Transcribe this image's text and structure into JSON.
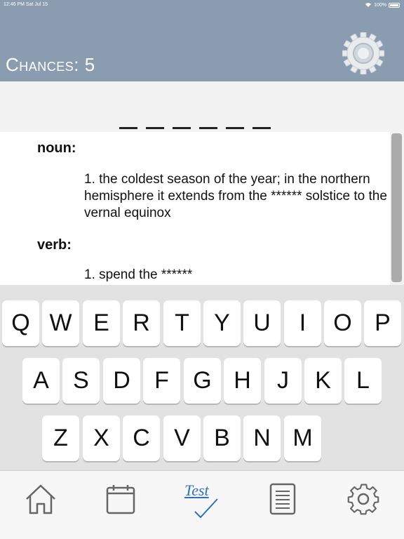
{
  "status": {
    "time": "12:46 PM  Sat Jul 15",
    "battery": "100%"
  },
  "header": {
    "chances_label": "Chances: 5"
  },
  "word": {
    "blank_count": 6
  },
  "definitions": [
    {
      "pos": "noun:",
      "text": "1. the coldest season of the year; in the northern hemisphere it extends from the ****** solstice to the vernal equinox"
    },
    {
      "pos": "verb:",
      "text": "1. spend the ******"
    }
  ],
  "keyboard": {
    "row1": [
      "Q",
      "W",
      "E",
      "R",
      "T",
      "Y",
      "U",
      "I",
      "O",
      "P"
    ],
    "row2": [
      "A",
      "S",
      "D",
      "F",
      "G",
      "H",
      "J",
      "K",
      "L"
    ],
    "row3": [
      "Z",
      "X",
      "C",
      "V",
      "B",
      "N",
      "M"
    ]
  },
  "tabs": [
    {
      "name": "home-icon"
    },
    {
      "name": "calendar-icon"
    },
    {
      "name": "test-icon",
      "label": "Test"
    },
    {
      "name": "document-icon"
    },
    {
      "name": "settings-icon"
    }
  ],
  "colors": {
    "header_bg": "#8a9db0",
    "test_tab_accent": "#2f6fc0"
  }
}
